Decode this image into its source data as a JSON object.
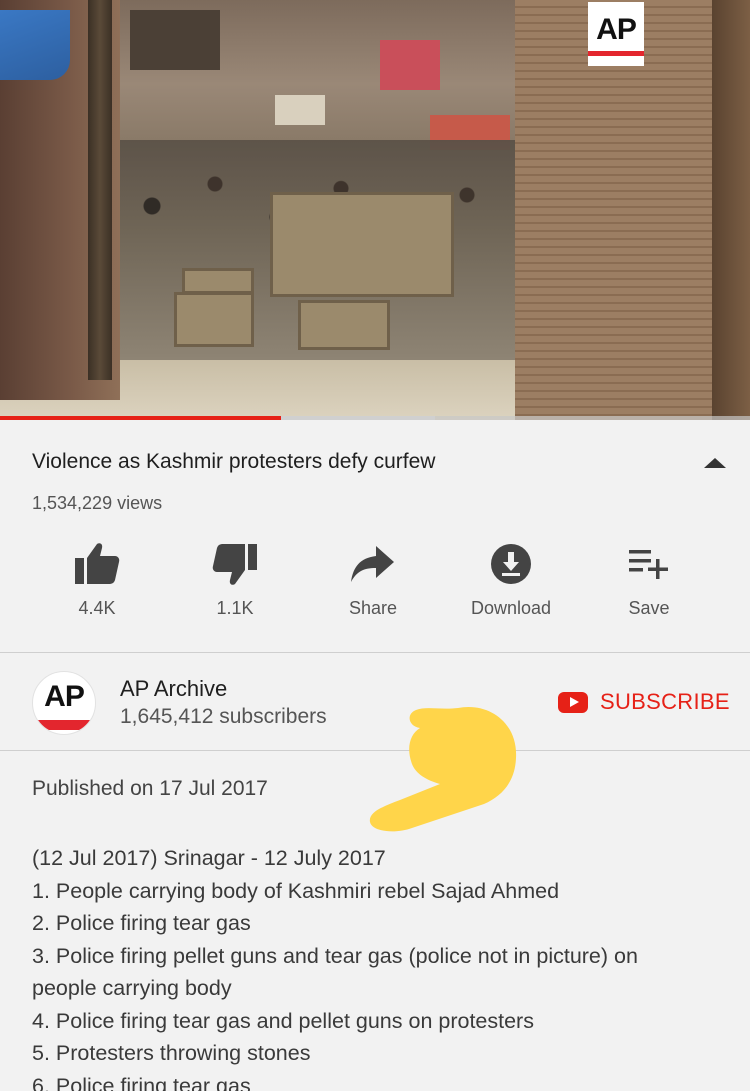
{
  "video": {
    "watermark": "AP",
    "progress_played": 0.375,
    "progress_buffered": 0.58
  },
  "title": "Violence as Kashmir protesters defy curfew",
  "views": "1,534,229 views",
  "actions": {
    "like": {
      "label": "4.4K",
      "icon": "thumbs-up-icon"
    },
    "dislike": {
      "label": "1.1K",
      "icon": "thumbs-down-icon"
    },
    "share": {
      "label": "Share",
      "icon": "share-arrow-icon"
    },
    "download": {
      "label": "Download",
      "icon": "download-icon"
    },
    "save": {
      "label": "Save",
      "icon": "playlist-add-icon"
    }
  },
  "channel": {
    "avatar_text": "AP",
    "name": "AP Archive",
    "subscribers": "1,645,412 subscribers",
    "subscribe_label": "SUBSCRIBE"
  },
  "description": {
    "published": "Published on 17 Jul 2017",
    "lines": [
      "(12 Jul 2017) Srinagar - 12 July 2017",
      "1. People carrying body of Kashmiri rebel Sajad Ahmed",
      "2. Police firing tear gas",
      "3. Police firing pellet guns and tear gas (police not in picture) on",
      "people carrying body",
      "4. Police firing tear gas and pellet guns on protesters",
      "5. Protesters throwing stones",
      "6. Police firing tear gas"
    ]
  },
  "colors": {
    "accent_red": "#e62117",
    "background": "#f2f2f2",
    "emoji_yellow": "#ffd54a"
  }
}
